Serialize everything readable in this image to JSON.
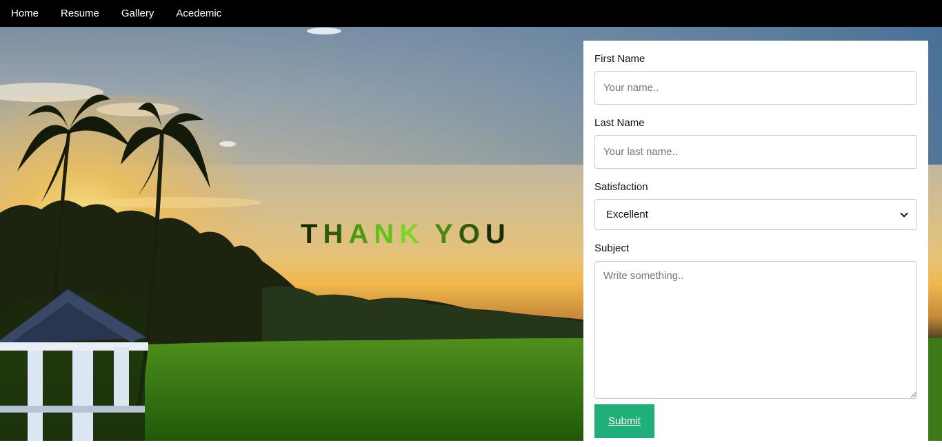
{
  "nav": {
    "items": [
      {
        "label": "Home"
      },
      {
        "label": "Resume"
      },
      {
        "label": "Gallery"
      },
      {
        "label": "Acedemic"
      }
    ]
  },
  "hero": {
    "headline_letters": [
      "T",
      "H",
      "A",
      "N",
      "K",
      " ",
      "Y",
      "O",
      "U"
    ],
    "headline_colors": [
      "#1a2e05",
      "#2e5c0a",
      "#4a9a12",
      "#5fc41a",
      "#7ad628",
      "#000000",
      "#4a8a10",
      "#2e5c0a",
      "#1a2e05"
    ]
  },
  "form": {
    "first_name": {
      "label": "First Name",
      "placeholder": "Your name.."
    },
    "last_name": {
      "label": "Last Name",
      "placeholder": "Your last name.."
    },
    "satisfaction": {
      "label": "Satisfaction",
      "selected": "Excellent"
    },
    "subject": {
      "label": "Subject",
      "placeholder": "Write something.."
    },
    "submit_label": "Submit"
  },
  "colors": {
    "navbar": "#000000",
    "submit": "#1fb07a"
  }
}
